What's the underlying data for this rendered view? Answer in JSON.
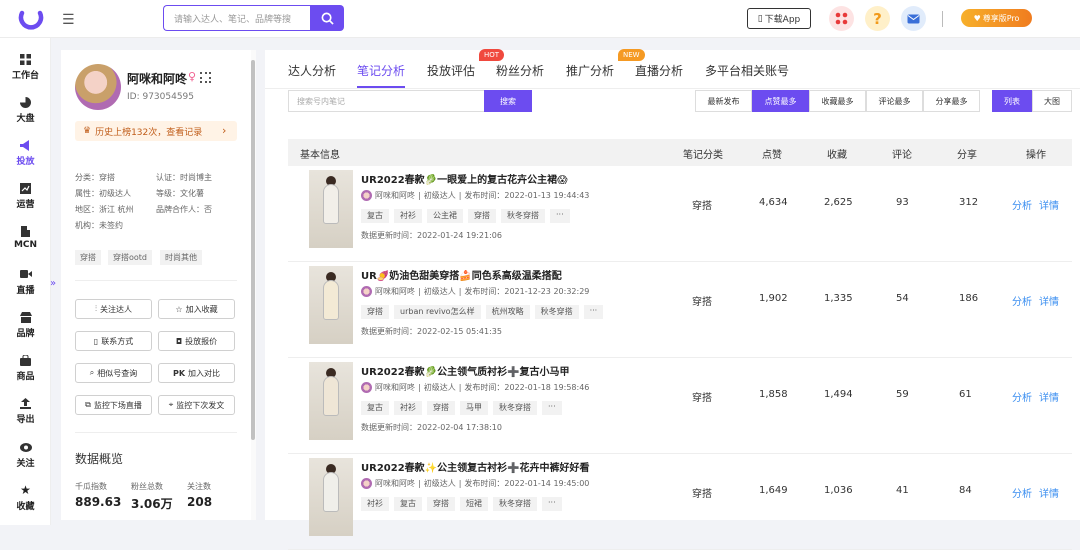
{
  "topbar": {
    "search_placeholder": "请输入达人、笔记、品牌等搜",
    "download_label": "下载App",
    "pro_label": "尊享版Pro",
    "colors": {
      "accent": "#6c4cf0",
      "pro": "#f29a1a"
    }
  },
  "nav": [
    {
      "label": "工作台",
      "icon": "grid-icon"
    },
    {
      "label": "大盘",
      "icon": "pie-chart-icon"
    },
    {
      "label": "投放",
      "icon": "megaphone-icon",
      "active": true
    },
    {
      "label": "运营",
      "icon": "trend-chart-icon"
    },
    {
      "label": "MCN",
      "icon": "building-icon"
    },
    {
      "label": "直播",
      "icon": "video-icon"
    },
    {
      "label": "品牌",
      "icon": "shop-icon"
    },
    {
      "label": "商品",
      "icon": "bag-icon"
    },
    {
      "label": "导出",
      "icon": "export-icon"
    },
    {
      "label": "关注",
      "icon": "eye-icon"
    },
    {
      "label": "收藏",
      "icon": "star-icon"
    }
  ],
  "profile": {
    "name": "阿咪和阿咚",
    "id_text": "ID: 973054595",
    "history": "历史上榜132次，查看记录",
    "attrs": {
      "category": "分类：穿搭",
      "verify": "认证：时尚博主",
      "attribute": "属性：初级达人",
      "level": "等级：文化薯",
      "region": "地区：浙江 杭州",
      "brand_partner": "品牌合作人：否",
      "agency": "机构：未签约"
    },
    "tags": [
      "穿搭",
      "穿搭ootd",
      "时尚其他"
    ],
    "buttons": [
      "关注达人",
      "加入收藏",
      "联系方式",
      "投放报价",
      "相似号查询",
      "加入对比",
      "监控下场直播",
      "监控下次发文"
    ],
    "overview_title": "数据概览",
    "stats": [
      {
        "label": "千瓜指数",
        "value": "889.63"
      },
      {
        "label": "粉丝总数",
        "value": "3.06万"
      },
      {
        "label": "关注数",
        "value": "208"
      }
    ]
  },
  "tabs": [
    {
      "label": "达人分析"
    },
    {
      "label": "笔记分析",
      "active": true
    },
    {
      "label": "投放评估"
    },
    {
      "label": "粉丝分析",
      "badge": "HOT"
    },
    {
      "label": "推广分析"
    },
    {
      "label": "直播分析",
      "badge": "NEW"
    },
    {
      "label": "多平台相关账号"
    }
  ],
  "toolbar": {
    "search_placeholder": "搜索号内笔记",
    "search_btn": "搜索",
    "sorts": [
      "最新发布",
      "点赞最多",
      "收藏最多",
      "评论最多",
      "分享最多"
    ],
    "active_sort": "点赞最多",
    "views": [
      "列表",
      "大图"
    ],
    "active_view": "列表"
  },
  "table": {
    "headers": [
      "基本信息",
      "笔记分类",
      "点赞",
      "收藏",
      "评论",
      "分享",
      "操作"
    ],
    "op_analyze": "分析",
    "op_detail": "详情",
    "rows": [
      {
        "title": "UR2022春款🥬一眼爱上的复古花卉公主裙😱",
        "author": "阿咪和阿咚",
        "level": "初级达人",
        "publish": "发布时间：2022-01-13 19:44:43",
        "tags": [
          "复古",
          "衬衫",
          "公主裙",
          "穿搭",
          "秋冬穿搭",
          "···"
        ],
        "update": "数据更新时间：2022-01-24 19:21:06",
        "category": "穿搭",
        "likes": "4,634",
        "collects": "2,625",
        "comments": "93",
        "shares": "312"
      },
      {
        "title": "UR🍠奶油色甜美穿搭🍰同色系高级温柔搭配",
        "author": "阿咪和阿咚",
        "level": "初级达人",
        "publish": "发布时间：2021-12-23 20:32:29",
        "tags": [
          "穿搭",
          "urban revivo怎么样",
          "杭州攻略",
          "秋冬穿搭",
          "···"
        ],
        "update": "数据更新时间：2022-02-15 05:41:35",
        "category": "穿搭",
        "likes": "1,902",
        "collects": "1,335",
        "comments": "54",
        "shares": "186"
      },
      {
        "title": "UR2022春款🥬公主领气质衬衫➕复古小马甲",
        "author": "阿咪和阿咚",
        "level": "初级达人",
        "publish": "发布时间：2022-01-18 19:58:46",
        "tags": [
          "复古",
          "衬衫",
          "穿搭",
          "马甲",
          "秋冬穿搭",
          "···"
        ],
        "update": "数据更新时间：2022-02-04 17:38:10",
        "category": "穿搭",
        "likes": "1,858",
        "collects": "1,494",
        "comments": "59",
        "shares": "61"
      },
      {
        "title": "UR2022春款✨公主领复古衬衫➕花卉中裤好好看",
        "author": "阿咪和阿咚",
        "level": "初级达人",
        "publish": "发布时间：2022-01-14 19:45:00",
        "tags": [
          "衬衫",
          "复古",
          "穿搭",
          "短裙",
          "秋冬穿搭",
          "···"
        ],
        "update": "",
        "category": "穿搭",
        "likes": "1,649",
        "collects": "1,036",
        "comments": "41",
        "shares": "84"
      }
    ]
  }
}
